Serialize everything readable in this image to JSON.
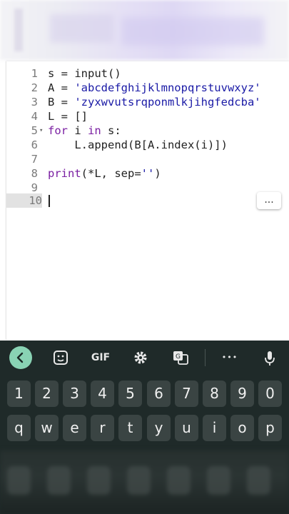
{
  "editor": {
    "lines": [
      {
        "num": "1",
        "text": "s = input()"
      },
      {
        "num": "2",
        "text": "A = 'abcdefghijklmnopqrstuvwxyz'"
      },
      {
        "num": "3",
        "text": "B = 'zyxwvutsrqponmlkjihgfedcba'"
      },
      {
        "num": "4",
        "text": "L = []"
      },
      {
        "num": "5",
        "text": "for i in s:"
      },
      {
        "num": "6",
        "text": "    L.append(B[A.index(i)])"
      },
      {
        "num": "7",
        "text": ""
      },
      {
        "num": "8",
        "text": "print(*L, sep='')"
      },
      {
        "num": "9",
        "text": ""
      },
      {
        "num": "10",
        "text": ""
      }
    ],
    "active_line": "10",
    "more_label": "..."
  },
  "keyboard": {
    "toolbar": {
      "back_icon": "chevron-left-icon",
      "sticker_icon": "sticker-icon",
      "gif_label": "GIF",
      "settings_icon": "gear-icon",
      "translate_icon": "translate-icon",
      "more_label": "•••",
      "mic_icon": "microphone-icon"
    },
    "numbers": [
      "1",
      "2",
      "3",
      "4",
      "5",
      "6",
      "7",
      "8",
      "9",
      "0"
    ],
    "letters": [
      "q",
      "w",
      "e",
      "r",
      "t",
      "y",
      "u",
      "i",
      "o",
      "p"
    ]
  },
  "colors": {
    "keyboard_bg": "#1f2a29",
    "key_bg": "#3a4443",
    "accent": "#89d3b4",
    "keyword": "#7a1fa2",
    "string": "#1a1aa6"
  }
}
